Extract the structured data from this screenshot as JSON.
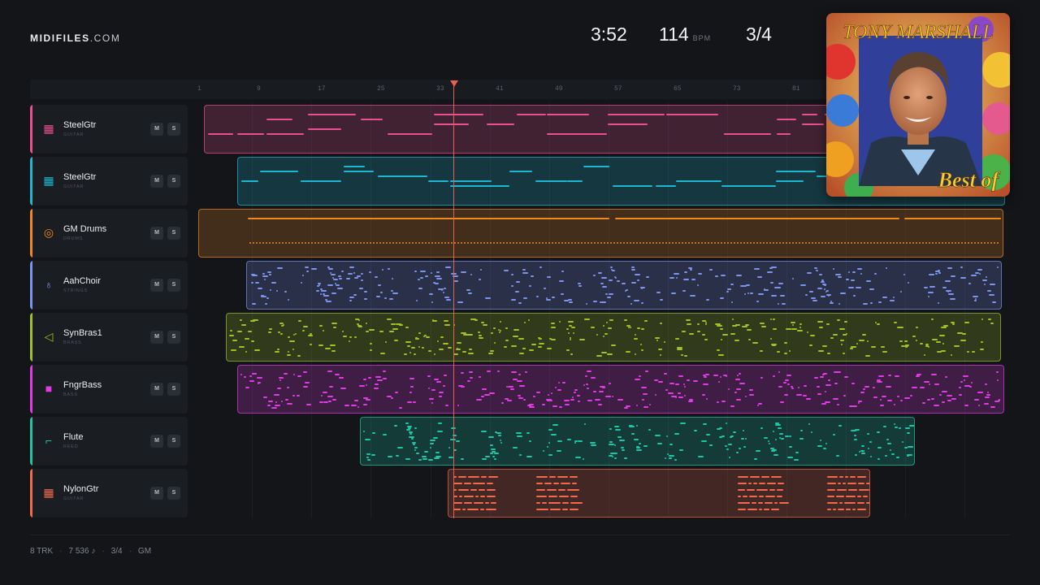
{
  "brand": {
    "name": "MIDIFILES",
    "domain": ".COM"
  },
  "stats": {
    "duration": "3:52",
    "tempo": "114",
    "tempo_unit": "BPM",
    "time_signature": "3/4"
  },
  "ruler": {
    "labels": [
      "1",
      "9",
      "17",
      "25",
      "33",
      "41",
      "49",
      "57",
      "65",
      "73",
      "81"
    ]
  },
  "playhead": {
    "label": "playhead"
  },
  "tracks": [
    {
      "name": "SteelGtr",
      "category": "GUITAR",
      "icon": "guitar-grid-icon",
      "glyph": "▦",
      "color": "#e8508f",
      "mute": "M",
      "solo": "S"
    },
    {
      "name": "SteelGtr",
      "category": "GUITAR",
      "icon": "guitar-grid-icon",
      "glyph": "▦",
      "color": "#1fb7cf",
      "mute": "M",
      "solo": "S"
    },
    {
      "name": "GM Drums",
      "category": "DRUMS",
      "icon": "drum-icon",
      "glyph": "◎",
      "color": "#ef8a1f",
      "mute": "M",
      "solo": "S"
    },
    {
      "name": "AahChoir",
      "category": "STRINGS",
      "icon": "violin-icon",
      "glyph": "♁",
      "color": "#7d93ec",
      "mute": "M",
      "solo": "S"
    },
    {
      "name": "SynBras1",
      "category": "BRASS",
      "icon": "horn-icon",
      "glyph": "◁",
      "color": "#a1c224",
      "mute": "M",
      "solo": "S"
    },
    {
      "name": "FngrBass",
      "category": "BASS",
      "icon": "bass-amp-icon",
      "glyph": "■",
      "color": "#e03be4",
      "mute": "M",
      "solo": "S"
    },
    {
      "name": "Flute",
      "category": "REED",
      "icon": "flute-icon",
      "glyph": "⌐",
      "color": "#1ec6a7",
      "mute": "M",
      "solo": "S"
    },
    {
      "name": "NylonGtr",
      "category": "GUITAR",
      "icon": "guitar-grid-icon",
      "glyph": "▦",
      "color": "#f06a4c",
      "mute": "M",
      "solo": "S"
    }
  ],
  "cover": {
    "artist": "TONY MARSHALL",
    "title": "Best of"
  },
  "footer": {
    "tracks": "8 TRK",
    "notes": "7 536 ♪",
    "signature": "3/4",
    "standard": "GM"
  }
}
